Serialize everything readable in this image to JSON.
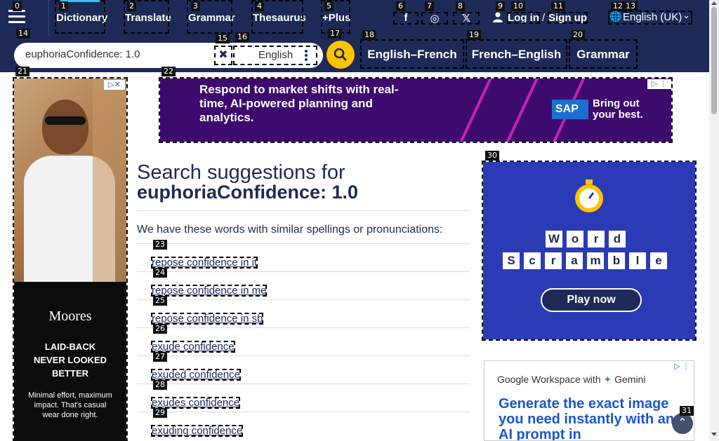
{
  "header": {
    "nav": [
      {
        "label": "Dictionary",
        "badge": "1"
      },
      {
        "label": "Translate",
        "badge": "2"
      },
      {
        "label": "Grammar",
        "badge": "3"
      },
      {
        "label": "Thesaurus",
        "badge": "4"
      },
      {
        "label": "+Plus",
        "badge": "5"
      }
    ],
    "menu_badge": "0",
    "social": [
      {
        "icon": "facebook-icon",
        "glyph": "f",
        "badge": "6"
      },
      {
        "icon": "instagram-icon",
        "glyph": "◎",
        "badge": "7"
      },
      {
        "icon": "x-icon",
        "glyph": "𝕏",
        "badge": "8"
      }
    ],
    "user_badge": "9",
    "login_label": "Log in",
    "login_badge": "10",
    "separator": " / ",
    "signup_label": "Sign up",
    "signup_badge": "11",
    "language_label": "English (UK)",
    "language_badges": [
      "12",
      "13"
    ]
  },
  "search": {
    "value": "euphoriaConfidence: 1.0",
    "badge": "14",
    "clear_badge": "15",
    "dictionary_select": "English",
    "select_badge": "16",
    "search_badge": "17",
    "tabs": [
      {
        "label": "English–French",
        "badge": "18"
      },
      {
        "label": "French–English",
        "badge": "19"
      },
      {
        "label": "Grammar",
        "badge": "20"
      }
    ]
  },
  "ads": {
    "left_badge": "21",
    "left_brand": "Moores",
    "left_headline": "LAID-BACK NEVER LOOKED BETTER",
    "left_body": "Minimal effort, maximum impact. That's casual wear done right.",
    "top_badge": "22",
    "top_headline": "Respond to market shifts with real-time, AI-powered planning and analytics.",
    "top_brand": "SAP",
    "top_tagline": "Bring out your best.",
    "right1_badge": "30",
    "right1_letters_1": [
      "W",
      "o",
      "r",
      "d"
    ],
    "right1_letters_2": [
      "S",
      "c",
      "r",
      "a",
      "m",
      "b",
      "l",
      "e"
    ],
    "right1_button": "Play now",
    "right2_header": "Google Workspace with",
    "right2_header_accent": "Gemini",
    "right2_body": "Generate the exact image you need instantly with an AI prompt in"
  },
  "main": {
    "heading_prefix": "Search suggestions for",
    "heading_term": "euphoriaConfidence: 1.0",
    "intro": "We have these words with similar spellings or pronunciations:",
    "suggestions": [
      {
        "label": "repose confidence in it",
        "badge": "23"
      },
      {
        "label": "repose confidence in me",
        "badge": "24"
      },
      {
        "label": "repose confidence in sb",
        "badge": "25"
      },
      {
        "label": "exude confidence",
        "badge": "26"
      },
      {
        "label": "exuded confidence",
        "badge": "27"
      },
      {
        "label": "exudes confidence",
        "badge": "28"
      },
      {
        "label": "exuding confidence",
        "badge": "29"
      }
    ]
  },
  "back_to_top_badge": "31",
  "colors": {
    "brand": "#1d2a57",
    "accent": "#fec400",
    "active": "#36c3f0"
  }
}
